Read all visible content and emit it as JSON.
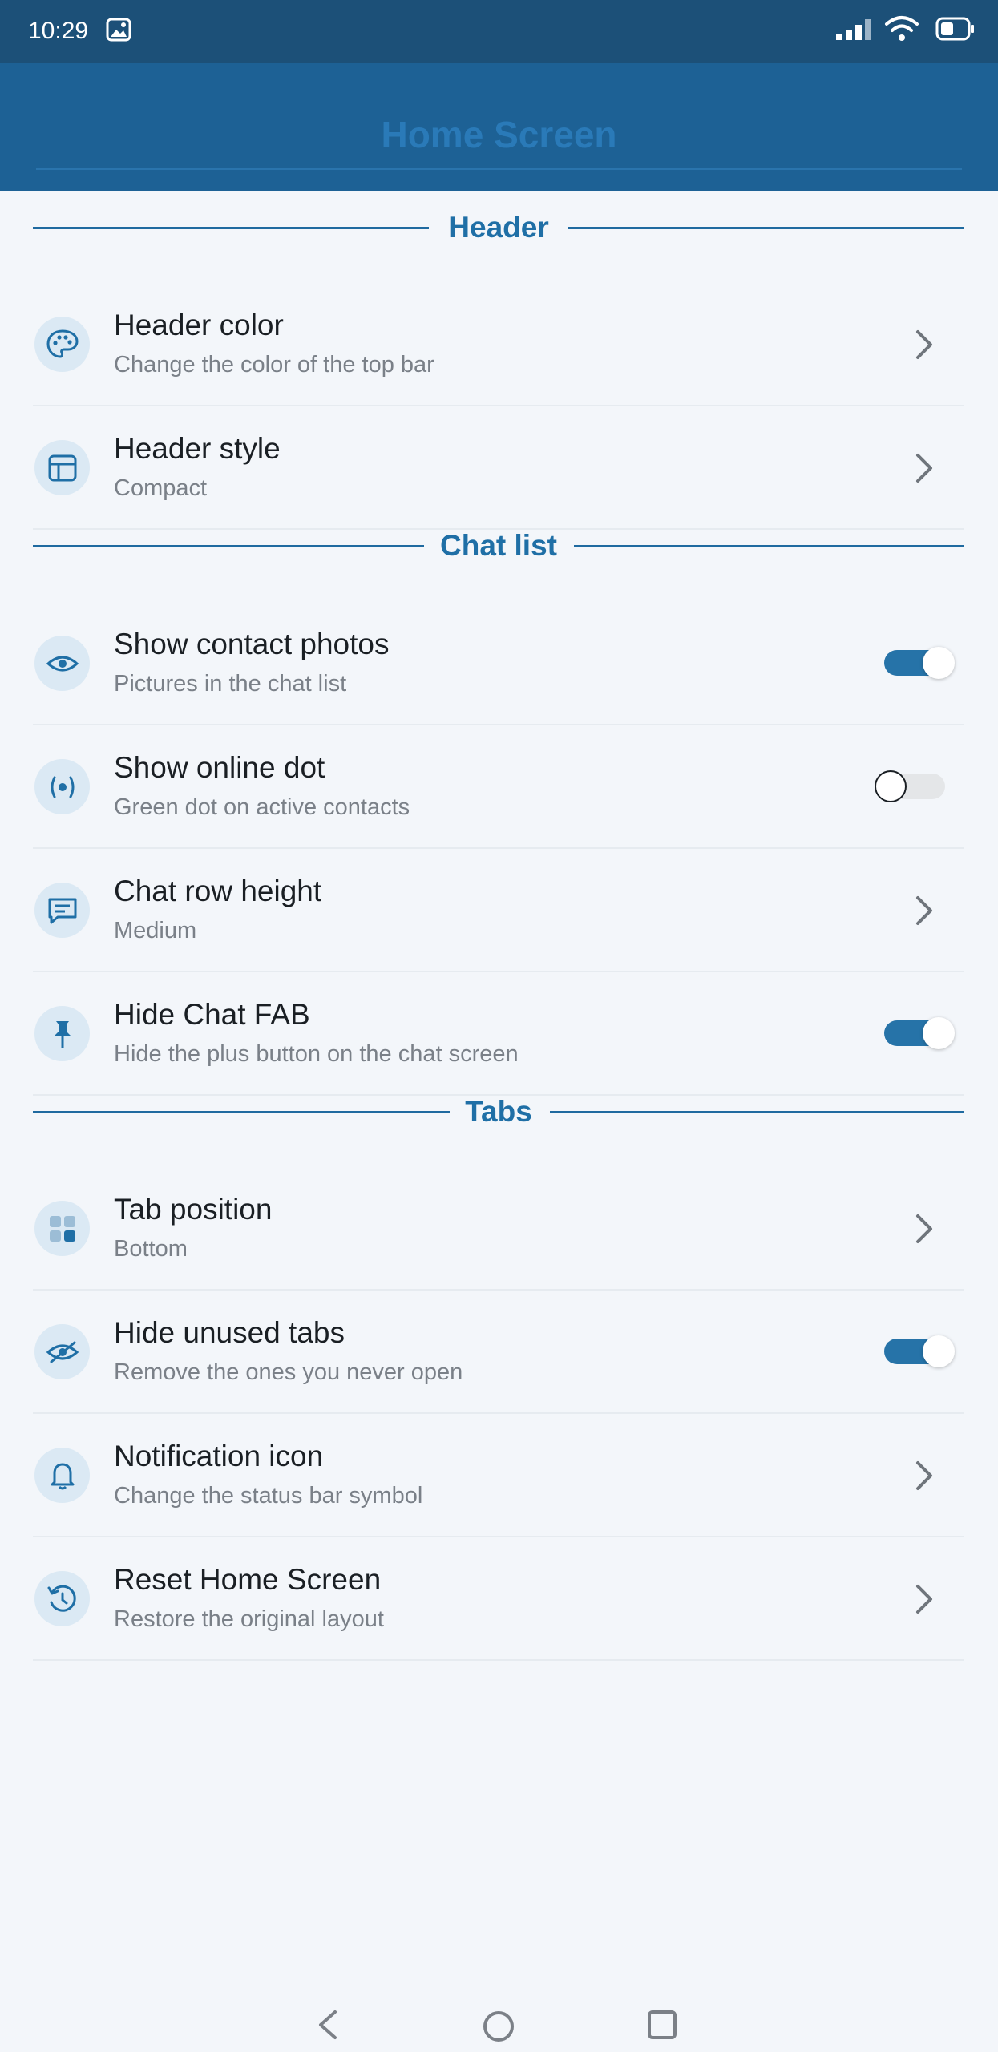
{
  "status_bar": {
    "time": "10:29",
    "icons": [
      "image-icon",
      "signal-icon",
      "wifi-icon",
      "battery-icon"
    ]
  },
  "app_bar": {
    "title": "Home Screen"
  },
  "sections": {
    "header": {
      "label": "Header",
      "items": [
        {
          "title": "Header color",
          "subtitle": "Change the color of the top bar",
          "icon": "palette-icon",
          "control": "chevron"
        },
        {
          "title": "Header style",
          "subtitle": "Compact",
          "icon": "layout-icon",
          "control": "chevron"
        }
      ]
    },
    "chat_list": {
      "label": "Chat list",
      "items": [
        {
          "title": "Show contact photos",
          "subtitle": "Pictures in the chat list",
          "icon": "eye-icon",
          "control": "toggle",
          "on": true
        },
        {
          "title": "Show online dot",
          "subtitle": "Green dot on active contacts",
          "icon": "radio-dot-icon",
          "control": "toggle",
          "on": false
        },
        {
          "title": "Chat row height",
          "subtitle": "Medium",
          "icon": "chat-bubble-icon",
          "control": "chevron"
        },
        {
          "title": "Hide Chat FAB",
          "subtitle": "Hide the plus button on the chat screen",
          "icon": "pin-icon",
          "control": "toggle",
          "on": true
        }
      ]
    },
    "tabs": {
      "label": "Tabs",
      "items": [
        {
          "title": "Tab position",
          "subtitle": "Bottom",
          "icon": "grid-icon",
          "control": "chevron"
        },
        {
          "title": "Hide unused tabs",
          "subtitle": "Remove the ones you never open",
          "icon": "eye-off-icon",
          "control": "toggle",
          "on": true
        },
        {
          "title": "Notification icon",
          "subtitle": "Change the status bar symbol",
          "icon": "bell-icon",
          "control": "chevron"
        },
        {
          "title": "Reset Home Screen",
          "subtitle": "Restore the original layout",
          "icon": "reset-icon",
          "control": "chevron"
        }
      ]
    }
  },
  "nav_bar": {
    "icons": [
      "back-icon",
      "home-icon",
      "recents-icon"
    ]
  },
  "colors": {
    "status_bar": "#1c5078",
    "app_bar": "#1d6195",
    "accent": "#1f6fa6",
    "toggle_on": "#2673a8",
    "background": "#f3f6fa"
  }
}
